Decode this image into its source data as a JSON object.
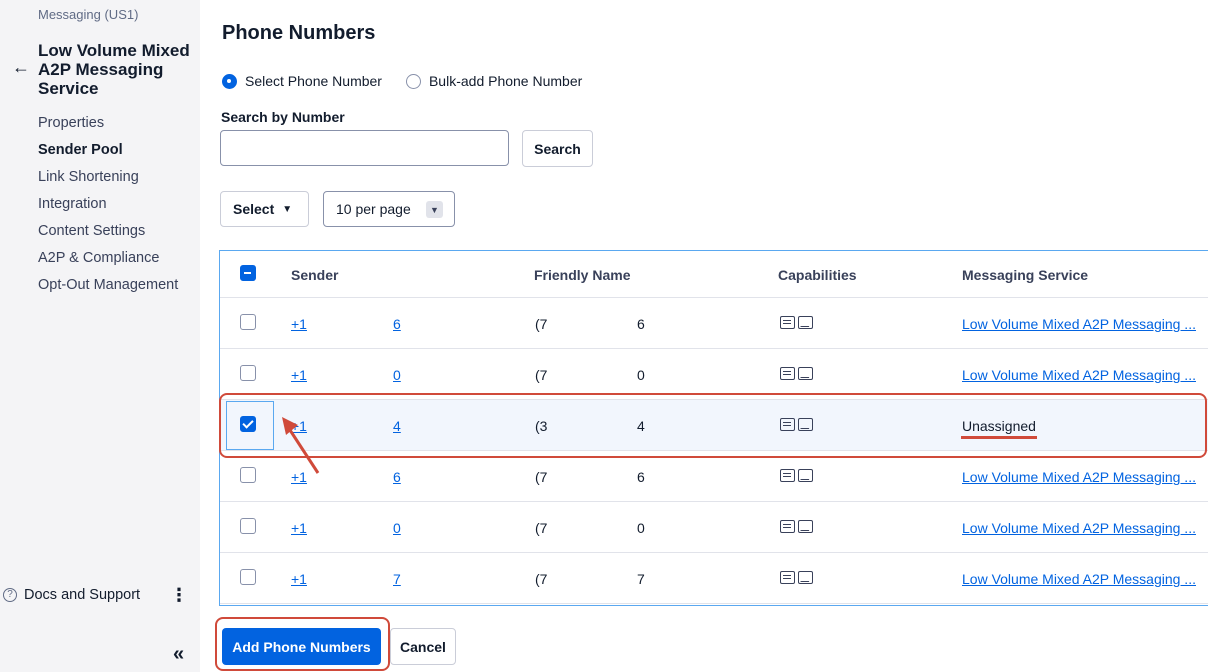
{
  "sidebar": {
    "breadcrumb": "Messaging (US1)",
    "title": "Low Volume Mixed A2P Messaging Service",
    "nav": [
      "Properties",
      "Sender Pool",
      "Link Shortening",
      "Integration",
      "Content Settings",
      "A2P & Compliance",
      "Opt-Out Management"
    ],
    "active_item": "Sender Pool",
    "docs_label": "Docs and Support",
    "collapse_icon": "«"
  },
  "main": {
    "title": "Phone Numbers",
    "radio_options": [
      "Select Phone Number",
      "Bulk-add Phone Number"
    ],
    "radio_selected": "Select Phone Number",
    "search_label": "Search by Number",
    "search_value": "",
    "search_button": "Search",
    "select_button": "Select",
    "per_page": "10 per page"
  },
  "table": {
    "columns": [
      "Sender",
      "Friendly Name",
      "Capabilities",
      "Messaging Service"
    ],
    "header_checkbox": "indeterminate",
    "rows": [
      {
        "checked": false,
        "sender_prefix": "+1",
        "sender_suffix": "6",
        "friendly_prefix": "(7",
        "friendly_suffix": "6",
        "service": "Low Volume Mixed A2P Messaging ...",
        "service_link": true
      },
      {
        "checked": false,
        "sender_prefix": "+1",
        "sender_suffix": "0",
        "friendly_prefix": "(7",
        "friendly_suffix": "0",
        "service": "Low Volume Mixed A2P Messaging ...",
        "service_link": true
      },
      {
        "checked": true,
        "sender_prefix": "+1",
        "sender_suffix": "4",
        "friendly_prefix": "(3",
        "friendly_suffix": "4",
        "service": "Unassigned",
        "service_link": false
      },
      {
        "checked": false,
        "sender_prefix": "+1",
        "sender_suffix": "6",
        "friendly_prefix": "(7",
        "friendly_suffix": "6",
        "service": "Low Volume Mixed A2P Messaging ...",
        "service_link": true
      },
      {
        "checked": false,
        "sender_prefix": "+1",
        "sender_suffix": "0",
        "friendly_prefix": "(7",
        "friendly_suffix": "0",
        "service": "Low Volume Mixed A2P Messaging ...",
        "service_link": true
      },
      {
        "checked": false,
        "sender_prefix": "+1",
        "sender_suffix": "7",
        "friendly_prefix": "(7",
        "friendly_suffix": "7",
        "service": "Low Volume Mixed A2P Messaging ...",
        "service_link": true
      }
    ]
  },
  "footer": {
    "add_button": "Add Phone Numbers",
    "cancel_button": "Cancel"
  },
  "colors": {
    "accent": "#0263e0",
    "annotation": "#d04a3a",
    "selected_row": "#f2f6fd"
  }
}
